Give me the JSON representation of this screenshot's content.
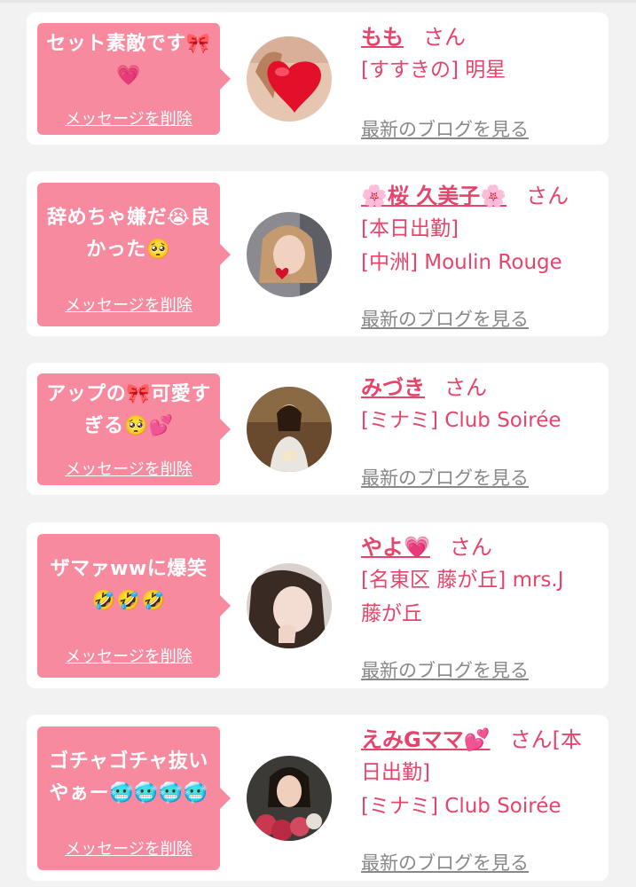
{
  "messages": [
    {
      "text_line1": "セット素敵です🎀",
      "text_line2": "💗",
      "delete_label": "メッセージを削除",
      "name": "もも",
      "honorific": "さん",
      "shop_line1": "[すすきの] 明星",
      "blog_link": "最新のブログを見る"
    },
    {
      "text_line1": "辞めちゃ嫌だ😭良",
      "text_line2": "かった🥺",
      "delete_label": "メッセージを削除",
      "name": "🌸桜 久美子🌸",
      "honorific": "さん",
      "shop_line1": "[本日出勤]",
      "shop_line2": "[中洲] Moulin Rouge",
      "blog_link": "最新のブログを見る"
    },
    {
      "text_line1": "アップの🎀可愛す",
      "text_line2": "ぎる🥺💕",
      "delete_label": "メッセージを削除",
      "name": "みづき",
      "honorific": "さん",
      "shop_line1": "[ミナミ] Club Soirée",
      "blog_link": "最新のブログを見る"
    },
    {
      "text_line1": "ザマァwwに爆笑",
      "text_line2": "🤣🤣🤣",
      "delete_label": "メッセージを削除",
      "name": "やよ💗",
      "honorific": "さん",
      "shop_line1": "[名東区 藤が丘] mrs.J",
      "shop_line2": "藤が丘",
      "blog_link": "最新のブログを見る"
    },
    {
      "text_line1": "ゴチャゴチャ抜い",
      "text_line2": "やぁー🥶🥶🥶🥶",
      "delete_label": "メッセージを削除",
      "name": "えみGママ💕",
      "honorific": "さん[本",
      "shop_line1": "日出勤]",
      "shop_line2": "[ミナミ] Club Soirée",
      "blog_link": "最新のブログを見る"
    }
  ],
  "colors": {
    "bubble": "#f78a9e",
    "accent": "#e8436a",
    "link_gray": "#888888",
    "background": "#f2f2f2"
  }
}
